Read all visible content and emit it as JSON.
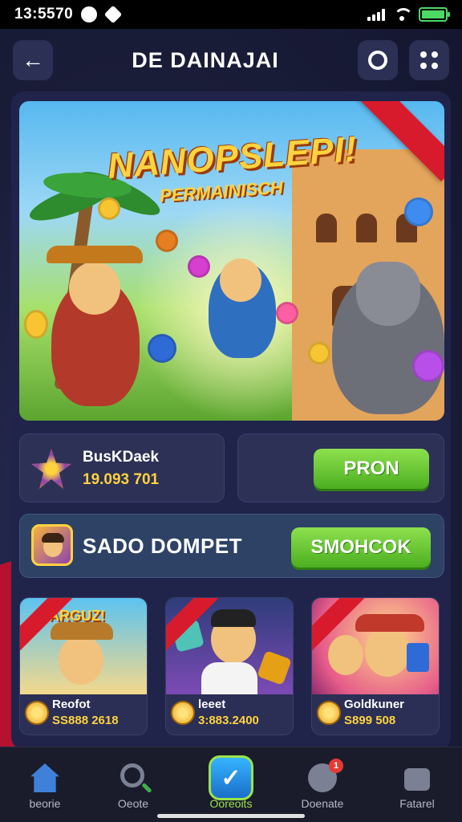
{
  "status_bar": {
    "time": "13:5570"
  },
  "header": {
    "title": "DE DAINAJAI"
  },
  "banner": {
    "title": "NANOPSLEPI!",
    "subtitle": "PERMAINISCH"
  },
  "balance_card": {
    "name": "BusKDaek",
    "value": "19.093 701"
  },
  "action_button": {
    "label": "PRON"
  },
  "wallet": {
    "label": "SADO DOMPET",
    "button_label": "SMOHCOK"
  },
  "games": [
    {
      "name": "Reofot",
      "value": "SS888 2618"
    },
    {
      "name": "leeet",
      "value": "3:883.2400"
    },
    {
      "name": "Goldkuner",
      "value": "S899 508"
    }
  ],
  "bottom_nav": {
    "items": [
      {
        "label": "beorie"
      },
      {
        "label": "Oeote"
      },
      {
        "label": "Ooreoits"
      },
      {
        "label": "Doenate",
        "badge": "1"
      },
      {
        "label": "Fatarel"
      }
    ]
  },
  "colors": {
    "accent_green": "#6cc63a",
    "accent_yellow": "#ffd23f",
    "ribbon_red": "#d81b2c"
  }
}
